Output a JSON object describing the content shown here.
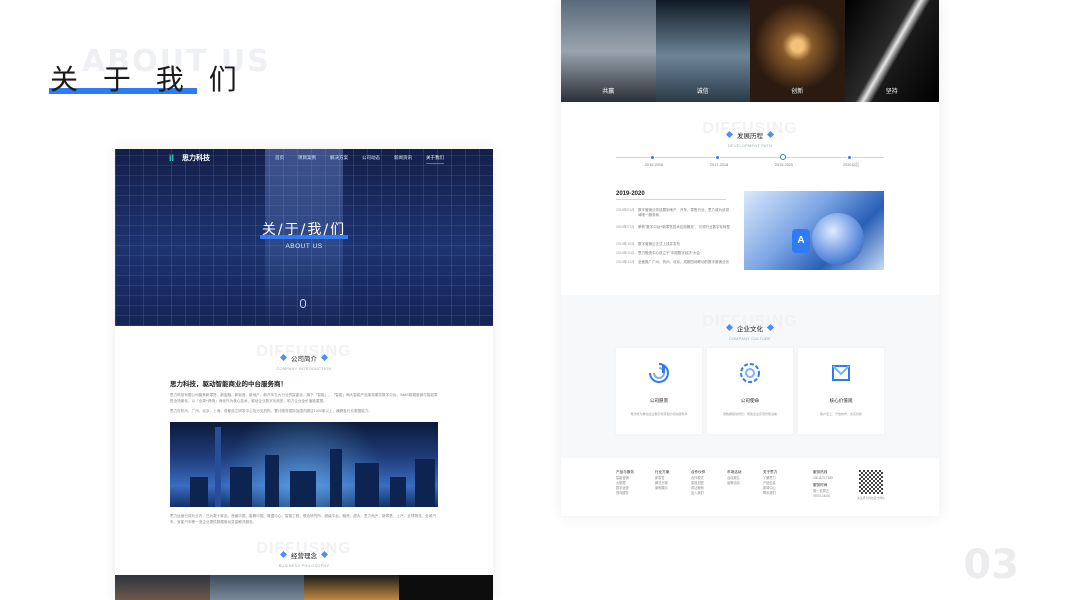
{
  "slide": {
    "bg_title": "ABOUT US",
    "title": "关 于 我 们",
    "page_number": "03",
    "accent_color": "#2f7bf5"
  },
  "left_mockup": {
    "logo_text": "思力科技",
    "logo_mark": "il",
    "nav": [
      "首页",
      "项目案例",
      "解决方案",
      "公司动态",
      "新闻资讯",
      "关于我们"
    ],
    "nav_active_index": 5,
    "hero_title": "关/于/我/们",
    "hero_subtitle": "ABOUT US",
    "intro_section": {
      "ghost": "DIFFUSING",
      "title": "公司简介",
      "subtitle": "COMPANY INTRODUCTION"
    },
    "intro_heading": "思力科技，驱动智能商业的中台服务商！",
    "intro_paragraph_1": "思力科技有限公司聚焦新零售、新金融、新制造、新地产、新汽车五大行业的智能化，旗下「智能」、「智能」两大智能产品架构服务数字中台、SaaS数据营销与智能零售全场景化，以「全周+跨场」两化作为核心技术，驱动企业数字化转型，助力企业全价值链重塑。",
    "intro_paragraph_2": "思力在杭州、广州、北京、上海、成都设立研发中心及分支机构，累计服务国际及国内超过1000家以上，横跨各行业数据能力。",
    "intro_paragraph_3": "思力运营已成为业内，已为数十家品、首届中国、客服中国、数据中心、智能工程、联合研究所、超级平台、融资、超大、思力地产、新零售、上汽、全球物流、全城汽车、宝能汽车等一流企业提供数据驱动变量解决服务。",
    "philosophy_section": {
      "ghost": "DIFFUSING",
      "title": "经营理念",
      "subtitle": "BUSINESS PHILOSOPHY"
    }
  },
  "right_mockup": {
    "tiles": [
      "共赢",
      "诚信",
      "创新",
      "坚持"
    ],
    "dev_section": {
      "ghost": "DIFFUSING",
      "title": "发展历程",
      "subtitle": "DEVELOPMENT PATH"
    },
    "timeline": [
      "2015-2016",
      "2017-2018",
      "2019-2020",
      "2020以后"
    ],
    "timeline_active_index": 2,
    "year_heading": "2019-2020",
    "events": [
      {
        "date": "2019年01月",
        "text": "数字营销业务延展到地产、汽车、零售行业，思力成为该领域唯一服务商"
      },
      {
        "date": "2019年07月",
        "text": "荣获\"数字中台+新零售技术应用服务\"，引领行业数字化转型"
      },
      {
        "date": "2019年10月",
        "text": "数字营销云正式上线并发布"
      },
      {
        "date": "2019年11月",
        "text": "思力融资中心成立于\"中国数字经济\"大会"
      },
      {
        "date": "2019年12月",
        "text": "全面推广广州、杭州、北京、成都四地联动的数字营销业务"
      }
    ],
    "culture_section": {
      "ghost": "DIFFUSING",
      "title": "企业文化",
      "subtitle": "COMPANY CULTURE"
    },
    "cards": [
      {
        "title": "公司愿景",
        "desc": "希望成为推动企业数字化转型的领先服务商"
      },
      {
        "title": "公司使命",
        "desc": "用数据驱动增长，帮助企业实现智能决策"
      },
      {
        "title": "核心价值观",
        "desc": "客户至上、开放协作、务实创新"
      }
    ],
    "footer": {
      "cols": [
        {
          "h": "产品与服务",
          "items": [
            "智能营销",
            "大数据",
            "数字运营",
            "咨询服务"
          ]
        },
        {
          "h": "行业方案",
          "items": [
            "新零售",
            "解决方案",
            "案例展示"
          ]
        },
        {
          "h": "合作伙伴",
          "items": [
            "合作模式",
            "渠道加盟",
            "成功案例",
            "加入我们"
          ]
        },
        {
          "h": "市场活动",
          "items": [
            "活动报名",
            "品牌活动"
          ]
        },
        {
          "h": "关于思力",
          "items": [
            "了解思力",
            "产品信息",
            "新闻中心",
            "联系我们"
          ]
        },
        {
          "h": "服务热线",
          "items": [
            "400-823-7389",
            "服务时间",
            "周一至周五",
            "09:00-18:00"
          ]
        }
      ],
      "qr_caption": "关注思力科技官方微信"
    }
  }
}
